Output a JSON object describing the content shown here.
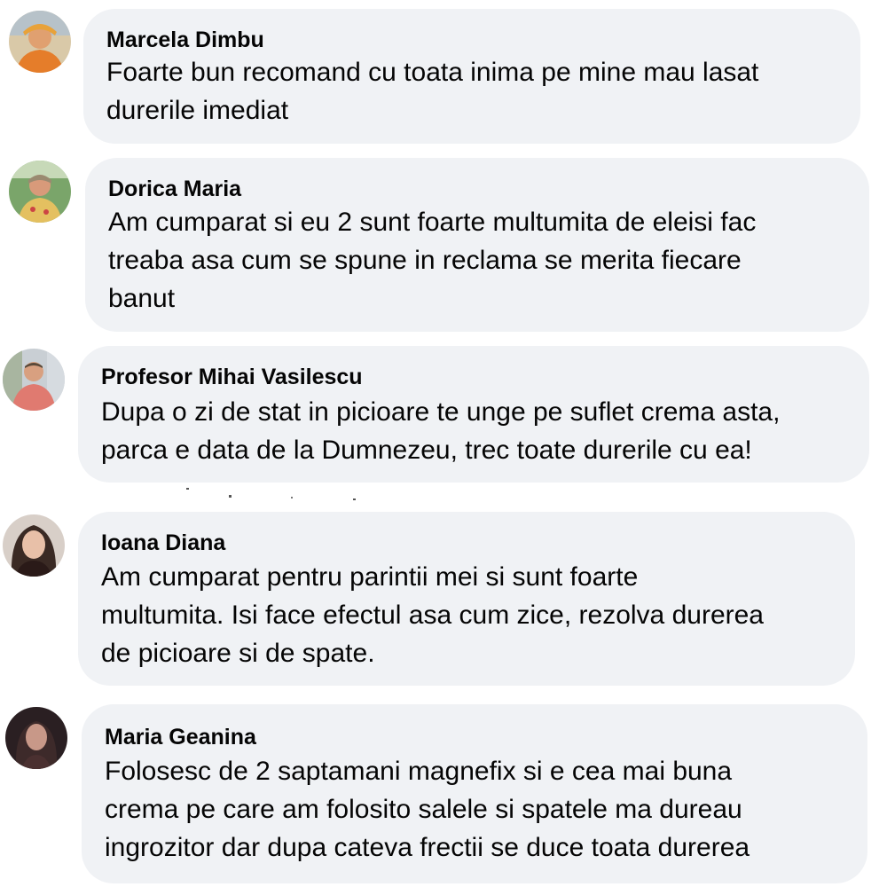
{
  "comments": [
    {
      "author": "Marcela Dimbu",
      "lines": [
        "Foarte bun recomand cu toata inima pe mine mau lasat",
        "durerile imediat"
      ]
    },
    {
      "author": "Dorica Maria",
      "lines": [
        "Am cumparat si eu 2 sunt foarte multumita de eleisi fac",
        "treaba asa cum se spune in reclama se merita fiecare",
        "banut"
      ]
    },
    {
      "author": "Profesor Mihai Vasilescu",
      "lines": [
        "Dupa o zi de stat in picioare te unge pe suflet crema asta,",
        "parca e data de la Dumnezeu, trec toate durerile cu ea!"
      ]
    },
    {
      "author": "Ioana Diana",
      "lines": [
        "Am cumparat pentru parintii mei si sunt foarte",
        "multumita. Isi face efectul asa cum zice, rezolva durerea",
        "de picioare si de spate."
      ]
    },
    {
      "author": "Maria Geanina",
      "lines": [
        "Folosesc de 2 saptamani magnefix si e cea mai buna",
        "crema pe care am folosito salele si spatele ma dureau",
        "ingrozitor dar dupa cateva frectii se duce toata durerea"
      ]
    }
  ],
  "colors": {
    "bubble": "#f0f2f5",
    "text": "#050505"
  }
}
